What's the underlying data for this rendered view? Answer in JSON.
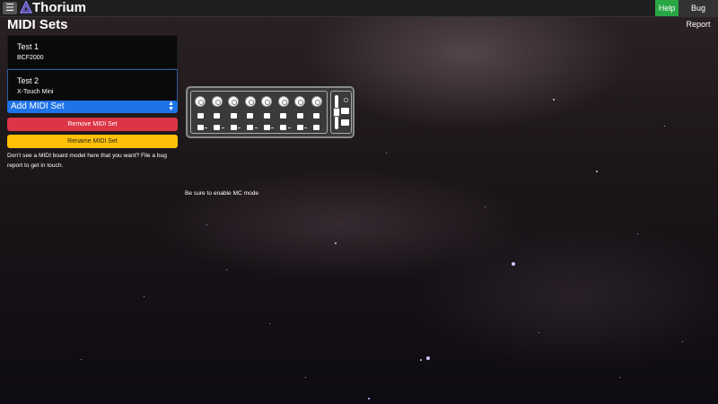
{
  "app": {
    "name": "Thorium"
  },
  "topbar": {
    "menu_icon": "hamburger-icon",
    "logo_icon": "thorium-logo-icon",
    "help_label": "Help",
    "bug_report_label": "Bug Report"
  },
  "page": {
    "title": "MIDI Sets"
  },
  "midi_sets": [
    {
      "name": "Test 1",
      "model": "BCF2000",
      "selected": false
    },
    {
      "name": "Test 2",
      "model": "X-Touch Mini",
      "selected": true
    }
  ],
  "add_select": {
    "label": "Add MIDI Set"
  },
  "actions": {
    "remove_label": "Remove MIDI Set",
    "rename_label": "Rename MIDI Set"
  },
  "help_text": "Don't see a MIDI board model here that you want? File a bug report to get in touch.",
  "device": {
    "note": "Be sure to enable MC mode",
    "knob_count": 8,
    "button_rows": 2
  },
  "colors": {
    "help": "#28a745",
    "add_select": "#1e73e8",
    "remove": "#dc3545",
    "rename": "#ffc107"
  }
}
